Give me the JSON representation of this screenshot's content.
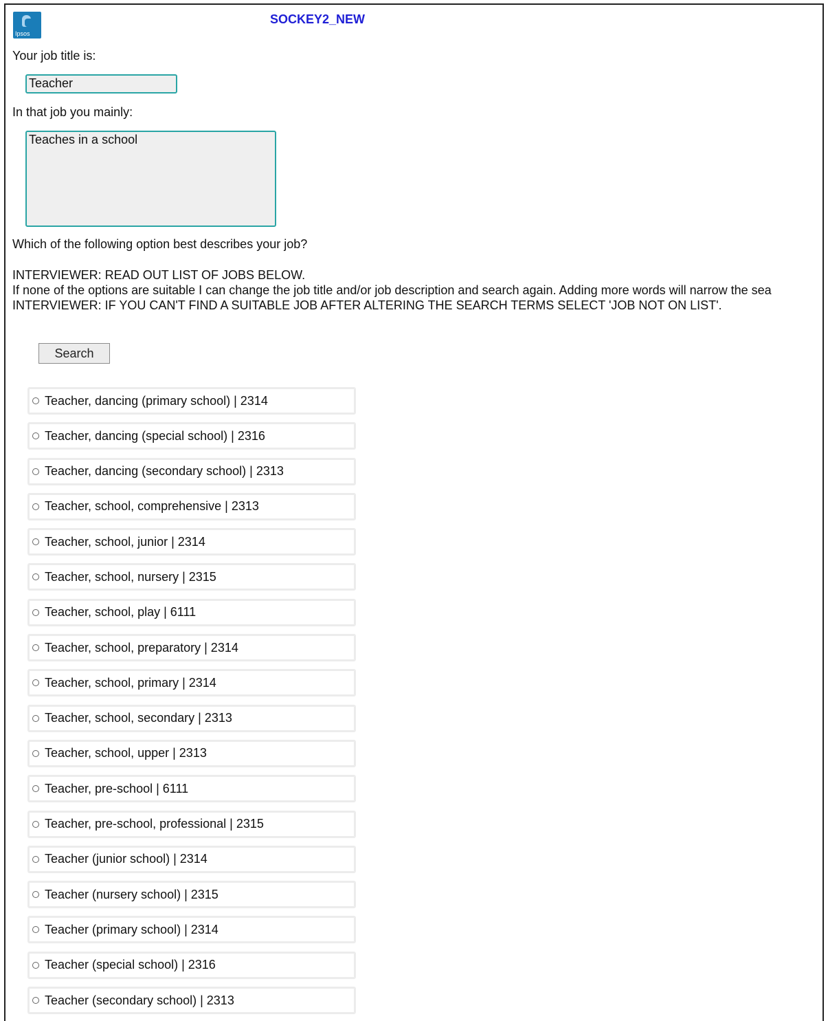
{
  "header": {
    "logo_text": "Ipsos",
    "title": "SOCKEY2_NEW"
  },
  "job_title": {
    "label": "Your job title is:",
    "value": "Teacher"
  },
  "job_description": {
    "label": "In that job you mainly:",
    "value": "Teaches in a school"
  },
  "question": "Which of the following option best describes your job?",
  "instructions": [
    "INTERVIEWER: READ OUT LIST OF JOBS BELOW.",
    "If none of the options are suitable I can change the job title and/or job description and search again. Adding more words will narrow the sea",
    "INTERVIEWER: IF YOU CAN'T FIND A SUITABLE JOB AFTER ALTERING THE SEARCH TERMS SELECT 'JOB NOT ON LIST'."
  ],
  "search_button": "Search",
  "options": [
    "Teacher, dancing (primary school) | 2314",
    "Teacher, dancing (special school) | 2316",
    "Teacher, dancing (secondary school) | 2313",
    "Teacher, school, comprehensive | 2313",
    "Teacher, school, junior | 2314",
    "Teacher, school, nursery | 2315",
    "Teacher, school, play | 6111",
    "Teacher, school, preparatory | 2314",
    "Teacher, school, primary | 2314",
    "Teacher, school, secondary | 2313",
    "Teacher, school, upper | 2313",
    "Teacher, pre-school | 6111",
    "Teacher, pre-school, professional | 2315",
    "Teacher (junior school) | 2314",
    "Teacher (nursery school) | 2315",
    "Teacher (primary school) | 2314",
    "Teacher (special school) | 2316",
    "Teacher (secondary school) | 2313"
  ],
  "colors": {
    "title": "#1f1fd6",
    "field_border": "#2aa5a5",
    "field_bg": "#efefef",
    "logo_bg": "#1a7db8"
  }
}
